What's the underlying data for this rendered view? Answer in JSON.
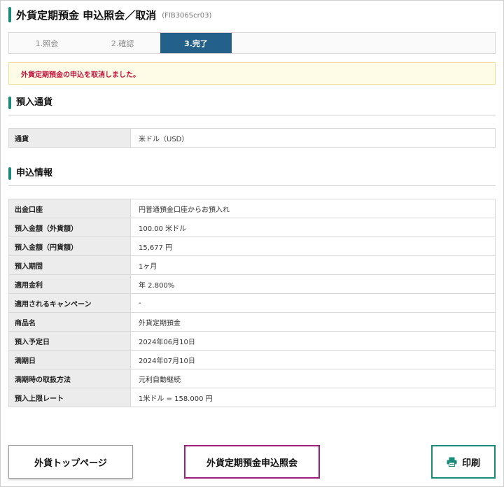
{
  "header": {
    "title": "外貨定期預金 申込照会／取消",
    "screen_id": "(FIB306Scr03)"
  },
  "stepper": {
    "steps": [
      {
        "label": "1.照会",
        "state": "done"
      },
      {
        "label": "2.確認",
        "state": "done"
      },
      {
        "label": "3.完了",
        "state": "current"
      }
    ]
  },
  "alert": {
    "message": "外貨定期預金の申込を取消しました。"
  },
  "currency_section": {
    "title": "預入通貨",
    "rows": [
      {
        "label": "通貨",
        "value": "米ドル（USD）"
      }
    ]
  },
  "application_section": {
    "title": "申込情報",
    "rows": [
      {
        "label": "出金口座",
        "value": "円普通預金口座からお預入れ"
      },
      {
        "label": "預入金額（外貨額）",
        "value": "100.00 米ドル"
      },
      {
        "label": "預入金額（円貨額）",
        "value": "15,677 円"
      },
      {
        "label": "預入期間",
        "value": "1ヶ月"
      },
      {
        "label": "適用金利",
        "value": "年 2.800%"
      },
      {
        "label": "適用されるキャンペーン",
        "value": "-"
      },
      {
        "label": "商品名",
        "value": "外貨定期預金"
      },
      {
        "label": "預入予定日",
        "value": "2024年06月10日"
      },
      {
        "label": "満期日",
        "value": "2024年07月10日"
      },
      {
        "label": "満期時の取扱方法",
        "value": "元利自動継続"
      },
      {
        "label": "預入上限レート",
        "value": "1米ドル = 158.000 円"
      }
    ]
  },
  "buttons": {
    "top_page": "外貨トップページ",
    "inquiry": "外貨定期預金申込照会",
    "print": "印刷",
    "print_icon": "printer-icon"
  },
  "colors": {
    "accent_green": "#1a8a79",
    "step_active": "#24618a",
    "alert_text": "#c0143c",
    "alert_bg": "#fefbe6",
    "inquiry_border": "#9c1f7c"
  }
}
